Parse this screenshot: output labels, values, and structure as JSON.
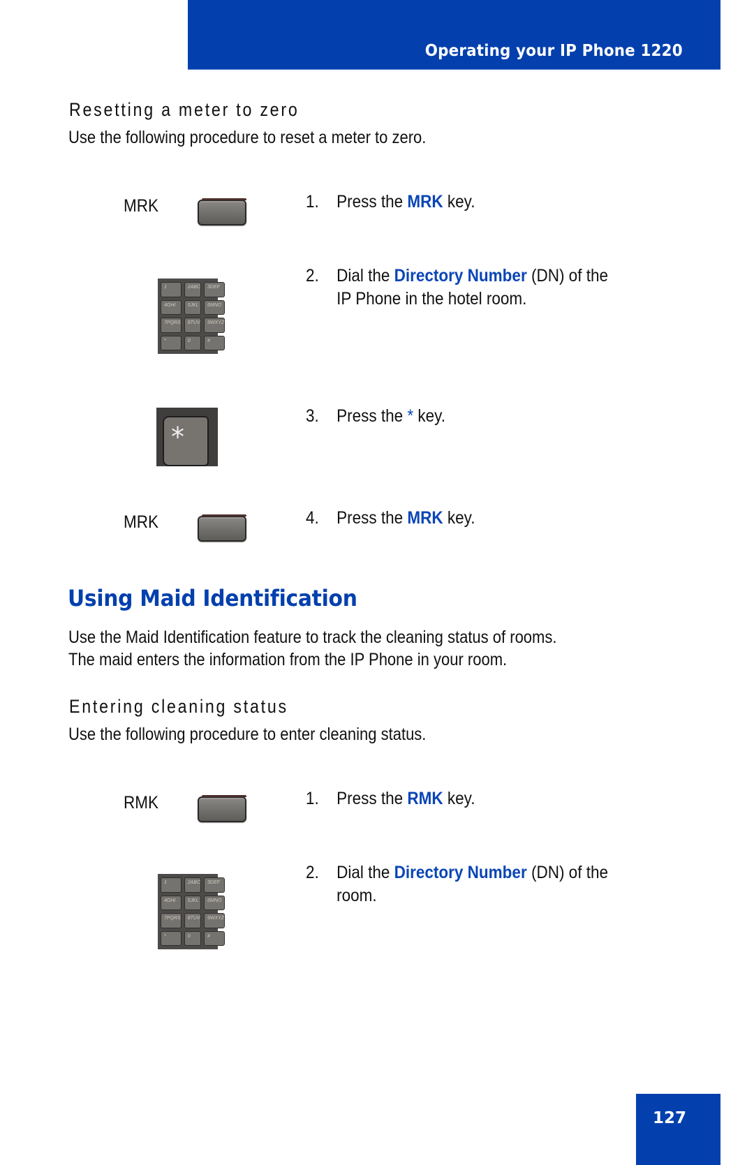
{
  "header": {
    "title": "Operating your IP Phone 1220",
    "band_color": "#0340ad"
  },
  "section_reset": {
    "heading": "Resetting a meter to zero",
    "intro": "Use the following procedure to reset a meter to zero.",
    "steps": [
      {
        "number": "1.",
        "prefix": "Press the ",
        "highlight": "MRK",
        "suffix": " key.",
        "icon_label": "MRK",
        "icon": "soft-key-icon"
      },
      {
        "number": "2.",
        "prefix": "Dial the ",
        "highlight": "Directory Number",
        "suffix": " (DN) of the",
        "continuation": "IP Phone in the hotel room.",
        "icon": "dialpad-icon"
      },
      {
        "number": "3.",
        "prefix": "Press the ",
        "highlight": "*",
        "suffix": " key.",
        "icon": "star-key-icon"
      },
      {
        "number": "4.",
        "prefix": "Press the ",
        "highlight": "MRK",
        "suffix": " key.",
        "icon_label": "MRK",
        "icon": "soft-key-icon"
      }
    ]
  },
  "section_maid": {
    "title": "Using Maid Identification",
    "intro_line1": "Use the Maid Identification feature to track the cleaning status of rooms.",
    "intro_line2": "The maid enters the information from the IP Phone in your room.",
    "subsection": {
      "heading": "Entering cleaning status",
      "intro": "Use the following procedure to enter cleaning status.",
      "steps": [
        {
          "number": "1.",
          "prefix": "Press the ",
          "highlight": "RMK",
          "suffix": " key.",
          "icon_label": "RMK",
          "icon": "soft-key-icon"
        },
        {
          "number": "2.",
          "prefix": "Dial the ",
          "highlight": "Directory Number",
          "suffix": " (DN) of the",
          "continuation": "room.",
          "icon": "dialpad-icon"
        }
      ]
    }
  },
  "keypad_keys": [
    "1",
    "2ABC",
    "3DEF",
    "4GHI",
    "5JKL",
    "6MNO",
    "7PQRS",
    "8TUV",
    "9WXYZ",
    "*",
    "0",
    "#"
  ],
  "star_key_glyph": "*",
  "footer": {
    "page_number": "127"
  },
  "colors": {
    "accent_blue": "#0340ad",
    "highlight_blue": "#0a45b5"
  }
}
